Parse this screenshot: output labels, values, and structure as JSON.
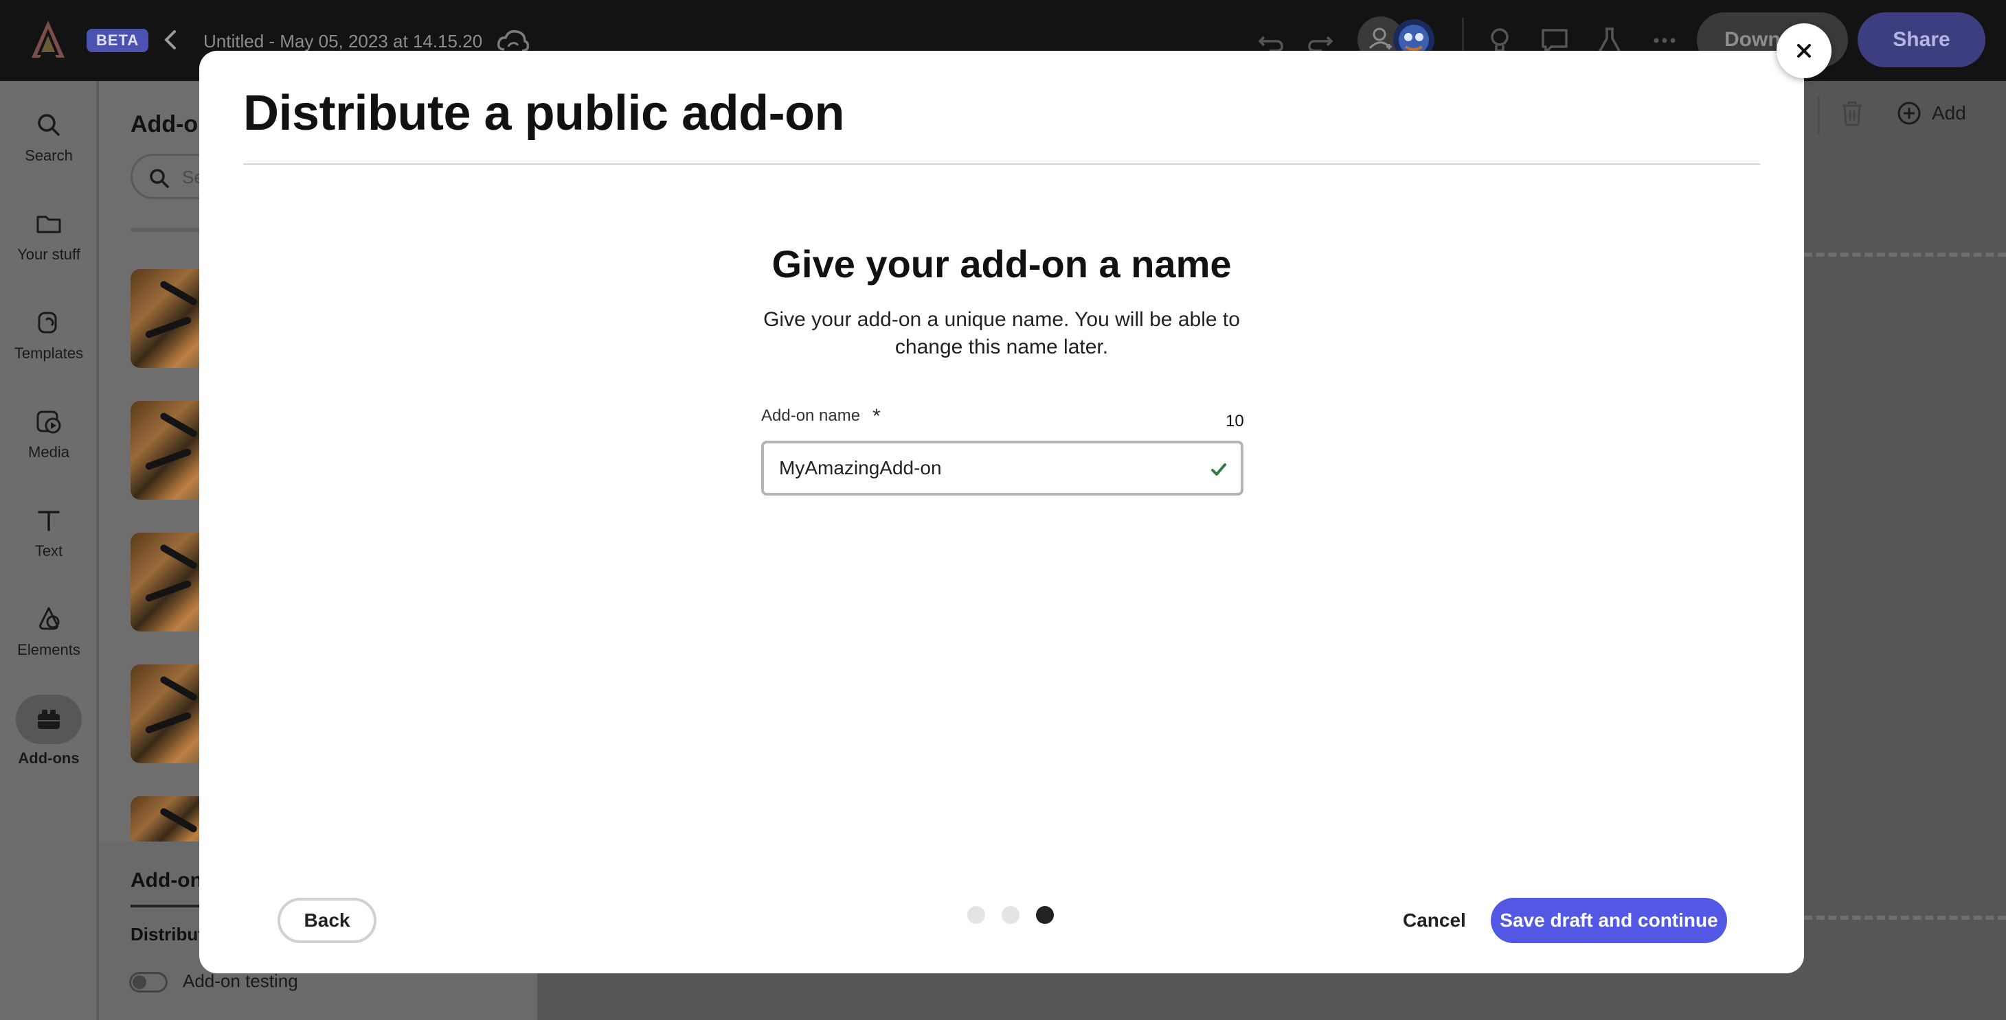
{
  "topbar": {
    "badge": "BETA",
    "document_title": "Untitled - May 05, 2023 at 14.15.20",
    "download_label": "Down",
    "share_label": "Share"
  },
  "rail": {
    "items": [
      {
        "label": "Search",
        "icon": "search-icon"
      },
      {
        "label": "Your stuff",
        "icon": "folder-icon"
      },
      {
        "label": "Templates",
        "icon": "templates-icon"
      },
      {
        "label": "Media",
        "icon": "media-icon"
      },
      {
        "label": "Text",
        "icon": "text-icon"
      },
      {
        "label": "Elements",
        "icon": "elements-icon"
      },
      {
        "label": "Add-ons",
        "icon": "add-ons-icon",
        "active": true
      }
    ]
  },
  "panel": {
    "title": "Add-o",
    "search_placeholder": "Se",
    "bottom_title": "Add-on",
    "distribute_label": "Distribut",
    "testing_label": "Add-on testing"
  },
  "canvas": {
    "add_label": "Add"
  },
  "modal": {
    "title": "Distribute a public add-on",
    "step_heading": "Give your add-on a name",
    "step_description": "Give your add-on a unique name. You will be able to change this name later.",
    "field": {
      "label": "Add-on name",
      "required_marker": "*",
      "char_count": "10",
      "value": "MyAmazingAdd-on"
    },
    "steps": {
      "total": 3,
      "current": 3
    },
    "back_label": "Back",
    "cancel_label": "Cancel",
    "save_label": "Save draft and continue"
  },
  "colors": {
    "primary_button": "#5258e4",
    "valid_check": "#2d7d46",
    "topbar": "#131313"
  }
}
